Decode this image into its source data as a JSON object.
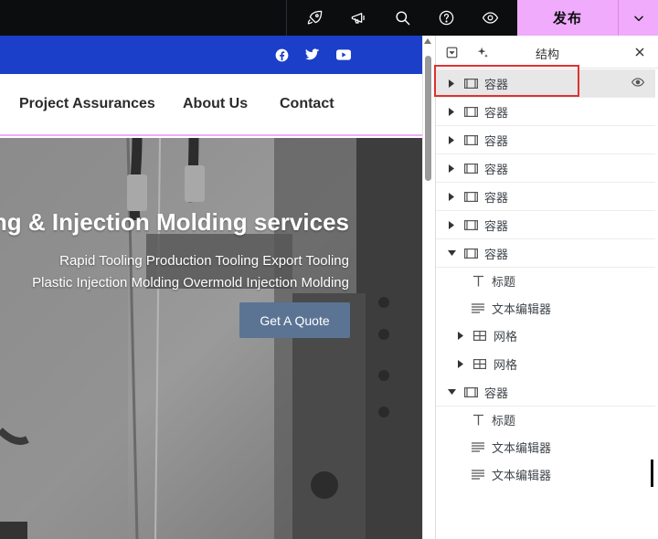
{
  "topbar": {
    "icons": [
      "rocket-icon",
      "megaphone-icon",
      "search-icon",
      "help-icon",
      "eye-icon"
    ],
    "publish_label": "发布",
    "publish_color": "#f0abfc"
  },
  "website": {
    "bluebar_color": "#1b3fc8",
    "social_icons": [
      "facebook-icon",
      "twitter-icon",
      "youtube-icon"
    ],
    "nav": [
      "Project Assurances",
      "About Us",
      "Contact"
    ],
    "hero": {
      "title": "ng & Injection Molding services",
      "subtitle_1": "Rapid Tooling Production Tooling Export Tooling",
      "subtitle_2": "Plastic Injection Molding Overmold Injection Molding",
      "cta": "Get A Quote",
      "cta_color": "#5b7494"
    }
  },
  "structure": {
    "title": "结构",
    "rows": [
      {
        "label": "容器",
        "type": "container",
        "caret": "right",
        "level": 0,
        "selected": true
      },
      {
        "label": "容器",
        "type": "container",
        "caret": "right",
        "level": 0
      },
      {
        "label": "容器",
        "type": "container",
        "caret": "right",
        "level": 0
      },
      {
        "label": "容器",
        "type": "container",
        "caret": "right",
        "level": 0
      },
      {
        "label": "容器",
        "type": "container",
        "caret": "right",
        "level": 0
      },
      {
        "label": "容器",
        "type": "container",
        "caret": "right",
        "level": 0
      },
      {
        "label": "容器",
        "type": "container",
        "caret": "down",
        "level": 0
      },
      {
        "label": "标题",
        "type": "heading",
        "caret": "none",
        "level": 1
      },
      {
        "label": "文本编辑器",
        "type": "text",
        "caret": "none",
        "level": 1
      },
      {
        "label": "网格",
        "type": "grid",
        "caret": "right",
        "level": 1
      },
      {
        "label": "网格",
        "type": "grid",
        "caret": "right",
        "level": 1
      },
      {
        "label": "容器",
        "type": "container",
        "caret": "down",
        "level": 0
      },
      {
        "label": "标题",
        "type": "heading",
        "caret": "none",
        "level": 1
      },
      {
        "label": "文本编辑器",
        "type": "text",
        "caret": "none",
        "level": 1
      },
      {
        "label": "文本编辑器",
        "type": "text",
        "caret": "none",
        "level": 1
      }
    ]
  }
}
